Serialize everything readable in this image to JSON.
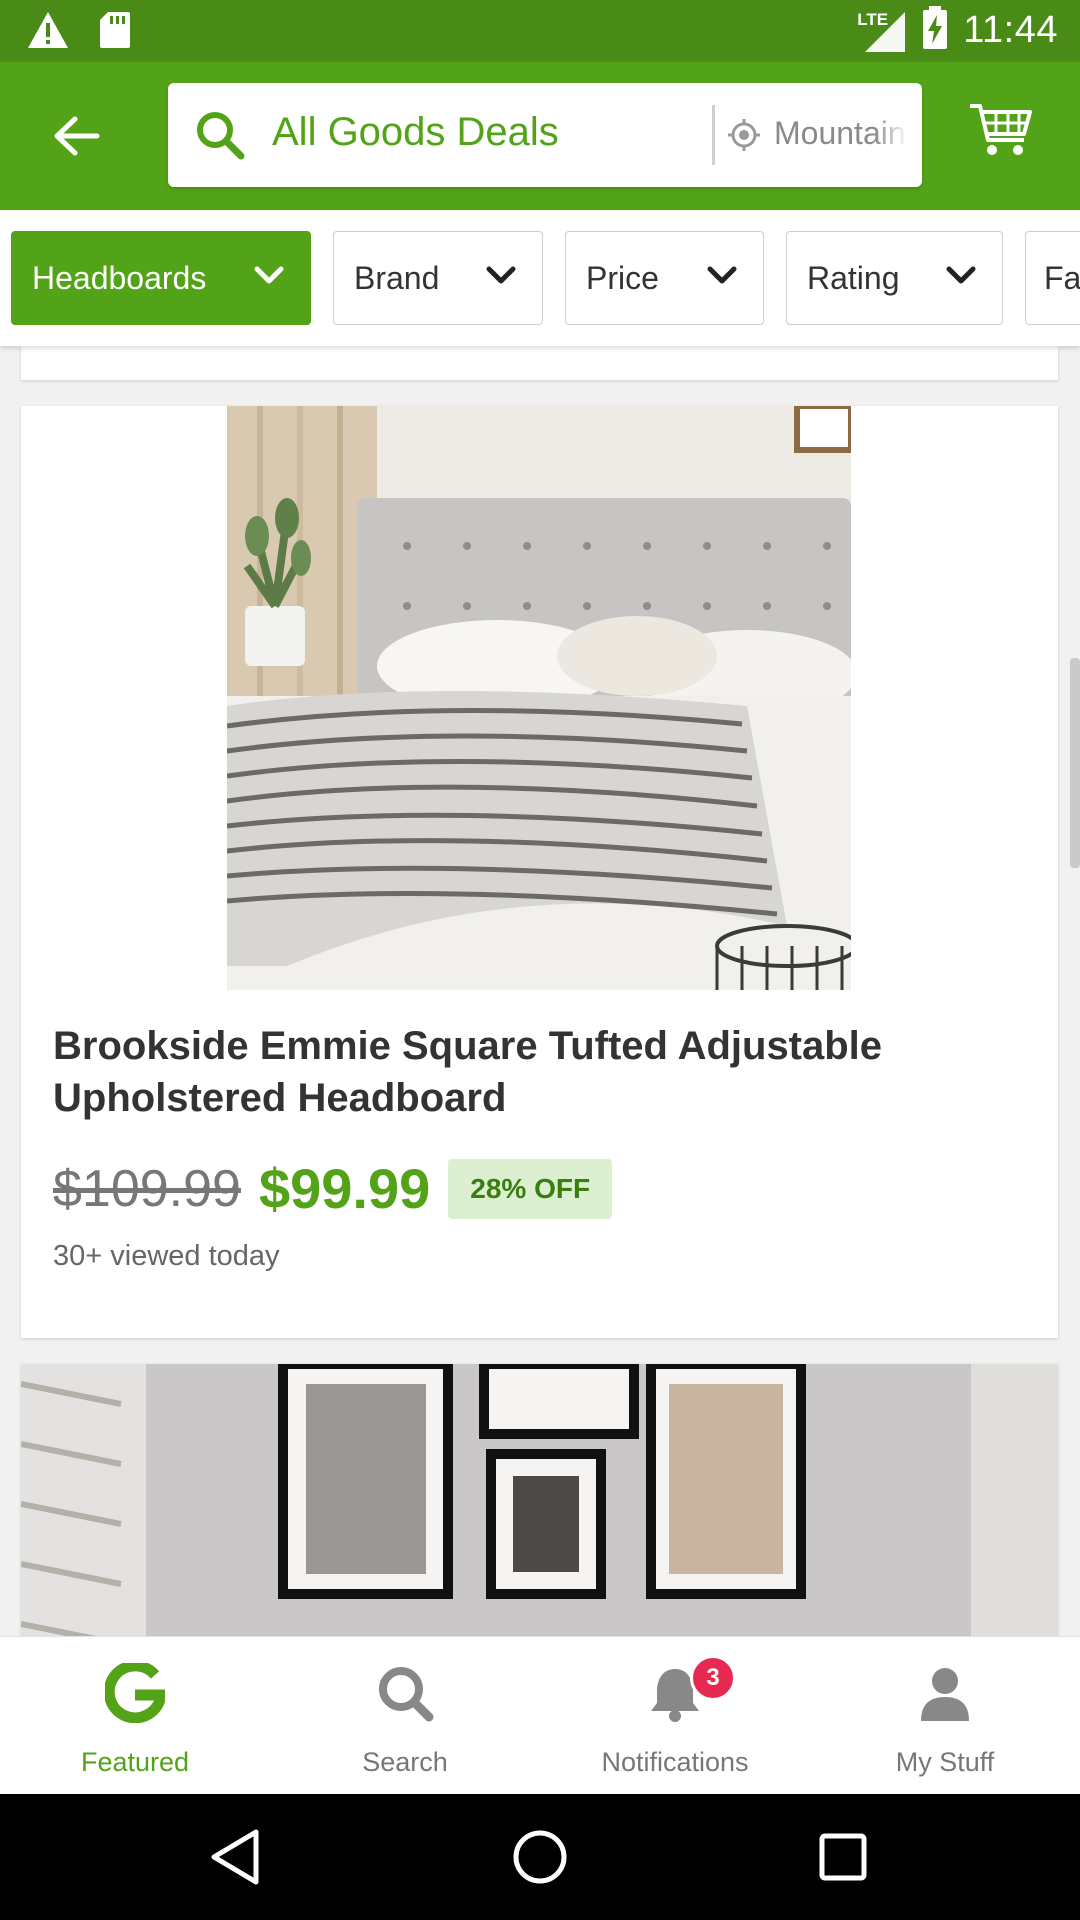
{
  "status_bar": {
    "network": "LTE",
    "time": "11:44",
    "icons": [
      "warning-icon",
      "sd-card-icon",
      "signal-icon",
      "battery-charging-icon"
    ]
  },
  "header": {
    "search_query": "All Goods Deals",
    "location": "Mountain View",
    "icons": [
      "back-arrow-icon",
      "search-icon",
      "location-icon",
      "cart-icon"
    ]
  },
  "filters": [
    {
      "label": "Headboards",
      "active": true
    },
    {
      "label": "Brand",
      "active": false
    },
    {
      "label": "Price",
      "active": false
    },
    {
      "label": "Rating",
      "active": false
    },
    {
      "label": "Fa",
      "active": false
    }
  ],
  "product": {
    "title": "Brookside Emmie Square Tufted Adjustable Upholstered Headboard",
    "original_price": "$109.99",
    "sale_price": "$99.99",
    "discount": "28% OFF",
    "views": "30+ viewed today"
  },
  "bottom_nav": {
    "items": [
      {
        "label": "Featured",
        "icon": "groupon-g-icon",
        "active": true
      },
      {
        "label": "Search",
        "icon": "search-icon",
        "active": false
      },
      {
        "label": "Notifications",
        "icon": "bell-icon",
        "active": false
      },
      {
        "label": "My Stuff",
        "icon": "person-icon",
        "active": false
      }
    ],
    "notification_count": "3"
  },
  "colors": {
    "brand_green": "#53a318",
    "status_green": "#4a8a16",
    "badge_red": "#e62950"
  }
}
